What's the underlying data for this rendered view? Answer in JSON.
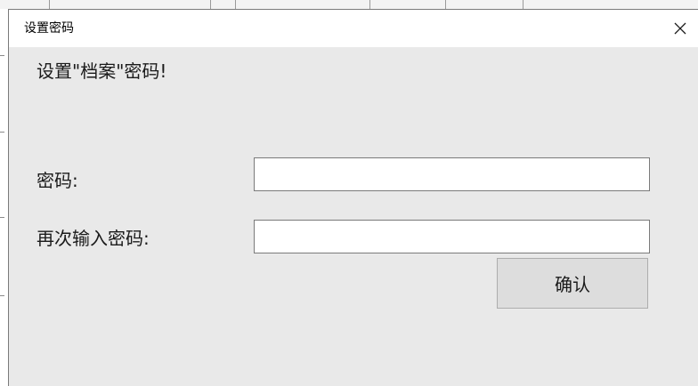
{
  "dialog": {
    "title": "设置密码",
    "close_icon": "close-icon"
  },
  "form": {
    "heading": "设置\"档案\"密码!",
    "password_label": "密码:",
    "password_value": "",
    "confirm_password_label": "再次输入密码:",
    "confirm_password_value": "",
    "confirm_button_label": "确认"
  },
  "colors": {
    "dialog_bg": "#e9e9e9",
    "titlebar_bg": "#ffffff",
    "button_bg": "#dddddd",
    "input_border": "#7a7a7a"
  }
}
